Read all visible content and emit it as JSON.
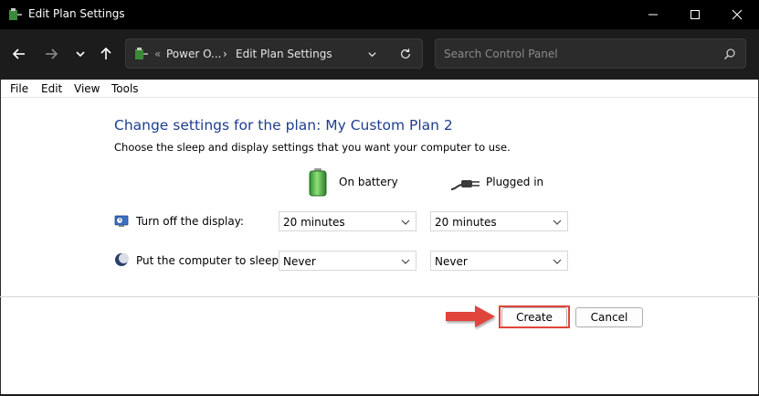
{
  "window": {
    "title": "Edit Plan Settings"
  },
  "nav": {
    "breadcrumb_separator_start": "«",
    "breadcrumb_item1": "Power O...",
    "breadcrumb_arrow": "›",
    "breadcrumb_item2": "Edit Plan Settings",
    "search_placeholder": "Search Control Panel"
  },
  "menu": {
    "file": "File",
    "edit": "Edit",
    "view": "View",
    "tools": "Tools"
  },
  "main": {
    "heading": "Change settings for the plan: My Custom Plan 2",
    "subheading": "Choose the sleep and display settings that you want your computer to use.",
    "col_battery": "On battery",
    "col_plugged": "Plugged in",
    "rows": [
      {
        "label": "Turn off the display:",
        "battery": "20 minutes",
        "plugged": "20 minutes"
      },
      {
        "label": "Put the computer to sleep:",
        "battery": "Never",
        "plugged": "Never"
      }
    ]
  },
  "buttons": {
    "create": "Create",
    "cancel": "Cancel"
  },
  "colors": {
    "accent_heading": "#1e3e8e",
    "highlight": "#e0453a"
  }
}
